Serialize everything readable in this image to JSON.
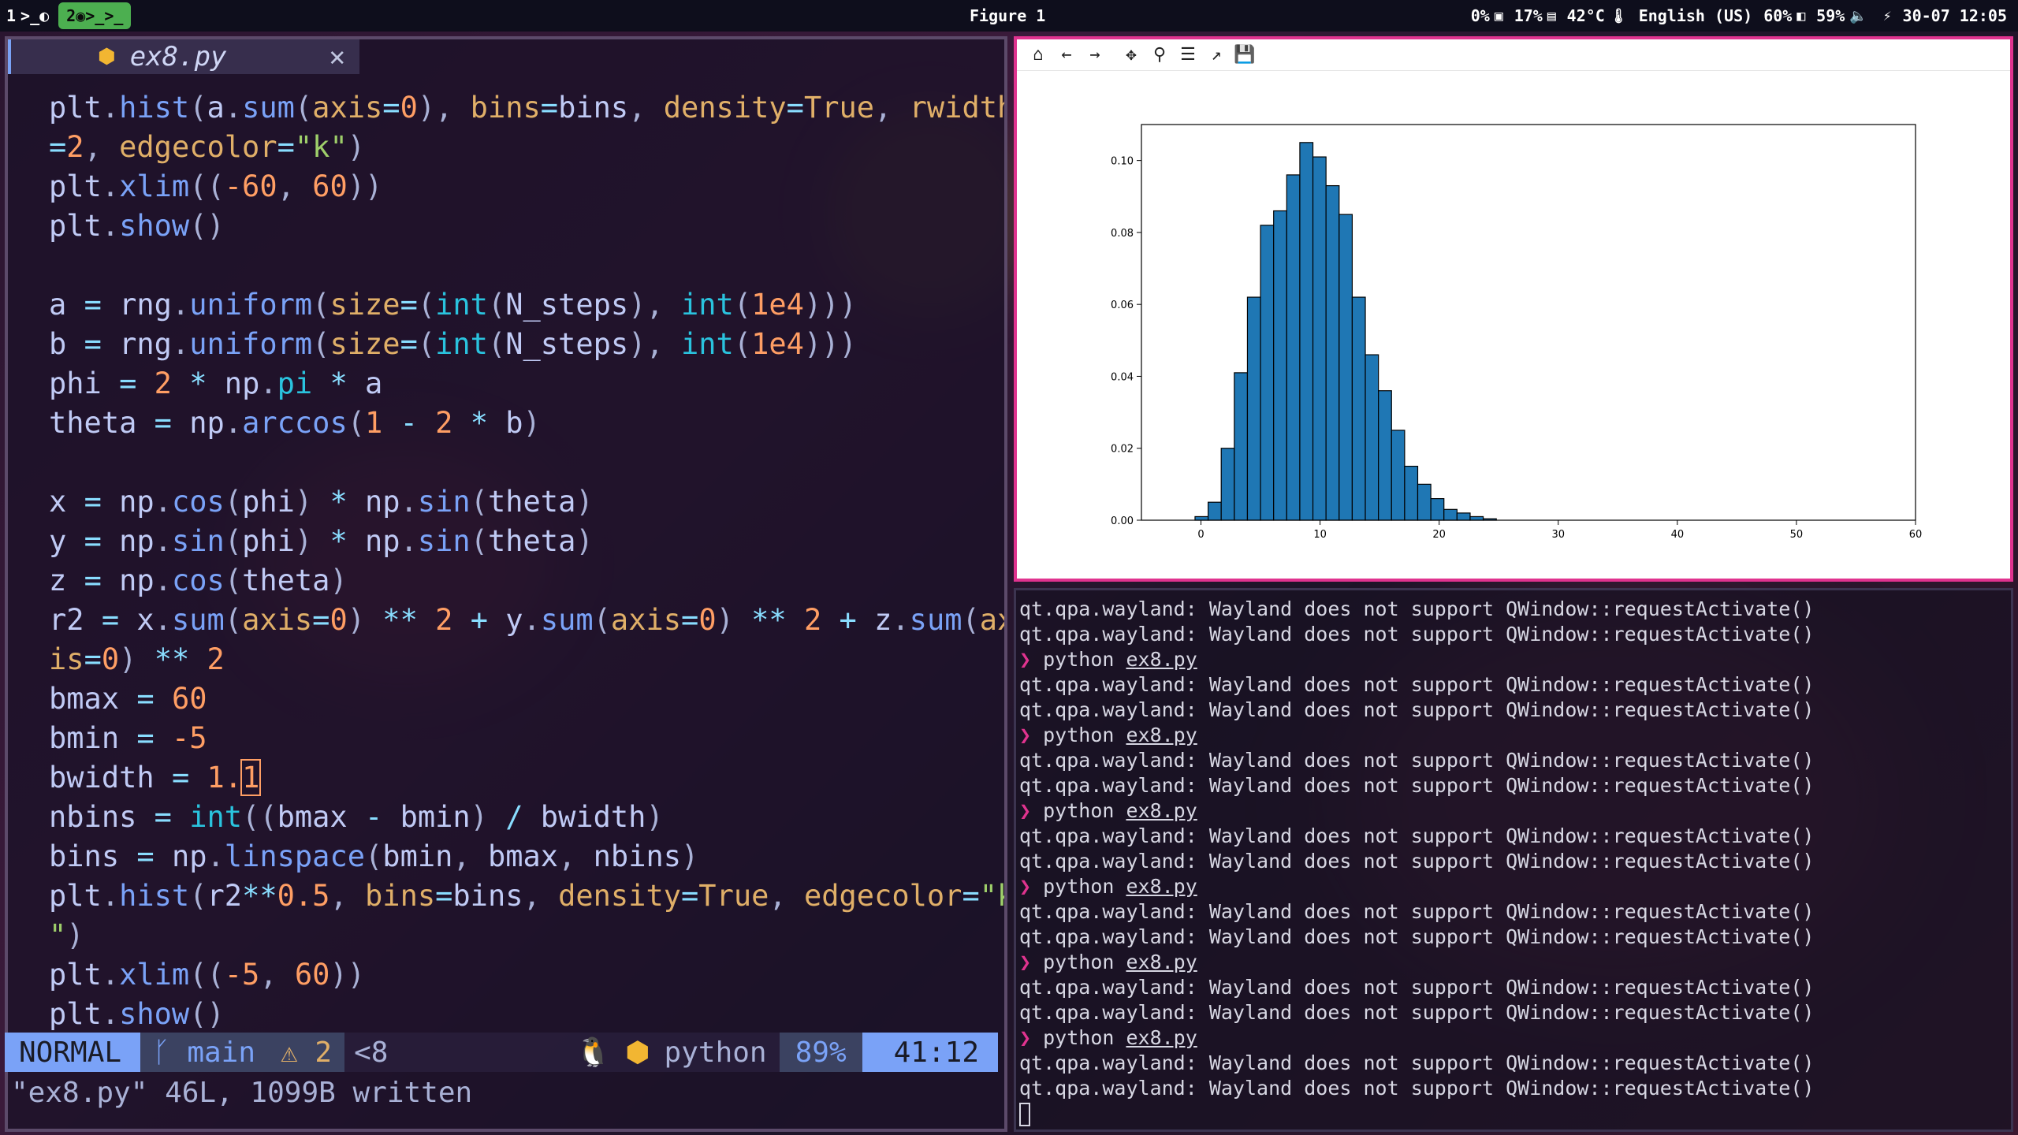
{
  "topbar": {
    "workspace1": "1",
    "workspace1_icons": ">_◐",
    "workspace2": "2",
    "workspace2_icons": "◉>_>_",
    "window_title": "Figure 1",
    "status": [
      {
        "icon": "cpu-icon",
        "glyph": "▣",
        "value": "0%"
      },
      {
        "icon": "memory-icon",
        "glyph": "▤",
        "value": "17%"
      },
      {
        "icon": "temperature-icon",
        "glyph": "🌡",
        "value": "42°C"
      },
      {
        "icon": "keyboard-layout",
        "glyph": "",
        "value": "English (US)"
      },
      {
        "icon": "display-brightness-icon",
        "glyph": "◧",
        "value": "60%"
      },
      {
        "icon": "volume-icon",
        "glyph": "🔈",
        "value": "59%"
      },
      {
        "icon": "battery-plug-icon",
        "glyph": "⚡",
        "value": ""
      },
      {
        "icon": "clock",
        "glyph": "",
        "value": "30-07 12:05"
      }
    ]
  },
  "editor": {
    "tab_filename": "ex8.py",
    "tab_icon": "python-icon",
    "statusline": {
      "mode": "NORMAL",
      "branch": "main",
      "warnings": "2",
      "diag": "<8",
      "filetype": "python",
      "percent": "89%",
      "position": "41:12"
    },
    "cmdline": "\"ex8.py\" 46L, 1099B written"
  },
  "figure": {
    "toolbar": [
      "home-icon",
      "back-icon",
      "forward-icon",
      "pan-icon",
      "zoom-icon",
      "configure-subplots-icon",
      "edit-axis-icon",
      "save-icon"
    ],
    "toolbar_glyphs": [
      "⌂",
      "←",
      "→",
      "✥",
      "⚲",
      "☰",
      "↗",
      "💾"
    ]
  },
  "chart_data": {
    "type": "bar",
    "title": "",
    "xlabel": "",
    "ylabel": "",
    "xlim": [
      -5,
      60
    ],
    "ylim": [
      0,
      0.11
    ],
    "xticks": [
      0,
      10,
      20,
      30,
      40,
      50,
      60
    ],
    "yticks": [
      "0.00",
      "0.02",
      "0.04",
      "0.06",
      "0.08",
      "0.10"
    ],
    "bin_width": 1.1,
    "bin_start": -5,
    "bar_color": "#1f77b4",
    "edge_color": "#000000",
    "bins_left": [
      -0.5,
      0.6,
      1.7,
      2.8,
      3.9,
      5.0,
      6.1,
      7.2,
      8.3,
      9.4,
      10.5,
      11.6,
      12.7,
      13.8,
      14.9,
      16.0,
      17.1,
      18.2,
      19.3,
      20.4,
      21.5,
      22.6,
      23.7
    ],
    "values": [
      0.001,
      0.005,
      0.02,
      0.041,
      0.062,
      0.082,
      0.086,
      0.096,
      0.105,
      0.101,
      0.093,
      0.085,
      0.062,
      0.046,
      0.036,
      0.025,
      0.015,
      0.01,
      0.006,
      0.003,
      0.002,
      0.001,
      0.0004
    ]
  },
  "terminal": {
    "lines": [
      {
        "kind": "out",
        "text": "qt.qpa.wayland: Wayland does not support QWindow::requestActivate()"
      },
      {
        "kind": "out",
        "text": "qt.qpa.wayland: Wayland does not support QWindow::requestActivate()"
      },
      {
        "kind": "cmd",
        "cmd": "python",
        "arg": "ex8.py"
      },
      {
        "kind": "out",
        "text": "qt.qpa.wayland: Wayland does not support QWindow::requestActivate()"
      },
      {
        "kind": "out",
        "text": "qt.qpa.wayland: Wayland does not support QWindow::requestActivate()"
      },
      {
        "kind": "cmd",
        "cmd": "python",
        "arg": "ex8.py"
      },
      {
        "kind": "out",
        "text": "qt.qpa.wayland: Wayland does not support QWindow::requestActivate()"
      },
      {
        "kind": "out",
        "text": "qt.qpa.wayland: Wayland does not support QWindow::requestActivate()"
      },
      {
        "kind": "cmd",
        "cmd": "python",
        "arg": "ex8.py"
      },
      {
        "kind": "out",
        "text": "qt.qpa.wayland: Wayland does not support QWindow::requestActivate()"
      },
      {
        "kind": "out",
        "text": "qt.qpa.wayland: Wayland does not support QWindow::requestActivate()"
      },
      {
        "kind": "cmd",
        "cmd": "python",
        "arg": "ex8.py"
      },
      {
        "kind": "out",
        "text": "qt.qpa.wayland: Wayland does not support QWindow::requestActivate()"
      },
      {
        "kind": "out",
        "text": "qt.qpa.wayland: Wayland does not support QWindow::requestActivate()"
      },
      {
        "kind": "cmd",
        "cmd": "python",
        "arg": "ex8.py"
      },
      {
        "kind": "out",
        "text": "qt.qpa.wayland: Wayland does not support QWindow::requestActivate()"
      },
      {
        "kind": "out",
        "text": "qt.qpa.wayland: Wayland does not support QWindow::requestActivate()"
      },
      {
        "kind": "cmd",
        "cmd": "python",
        "arg": "ex8.py"
      },
      {
        "kind": "out",
        "text": "qt.qpa.wayland: Wayland does not support QWindow::requestActivate()"
      },
      {
        "kind": "out",
        "text": "qt.qpa.wayland: Wayland does not support QWindow::requestActivate()"
      }
    ]
  },
  "code_lines": [
    [
      [
        "plt",
        "v"
      ],
      [
        ".",
        "p"
      ],
      [
        "hist",
        "f"
      ],
      [
        "(",
        "p"
      ],
      [
        "a",
        "v"
      ],
      [
        ".",
        "p"
      ],
      [
        "sum",
        "f"
      ],
      [
        "(",
        "p"
      ],
      [
        "axis",
        "k"
      ],
      [
        "=",
        "o"
      ],
      [
        "0",
        "n"
      ],
      [
        "), ",
        "p"
      ],
      [
        "bins",
        "k"
      ],
      [
        "=",
        "o"
      ],
      [
        "bins",
        "v"
      ],
      [
        ", ",
        "p"
      ],
      [
        "density",
        "k"
      ],
      [
        "=",
        "o"
      ],
      [
        "True",
        "k"
      ],
      [
        ", ",
        "p"
      ],
      [
        "rwidth",
        "k"
      ]
    ],
    [
      [
        "=",
        "o"
      ],
      [
        "2",
        "n"
      ],
      [
        ", ",
        "p"
      ],
      [
        "edgecolor",
        "k"
      ],
      [
        "=",
        "o"
      ],
      [
        "\"k\"",
        "s"
      ],
      [
        ")",
        "p"
      ]
    ],
    [
      [
        "plt",
        "v"
      ],
      [
        ".",
        "p"
      ],
      [
        "xlim",
        "f"
      ],
      [
        "((",
        "p"
      ],
      [
        "-60",
        "n"
      ],
      [
        ", ",
        "p"
      ],
      [
        "60",
        "n"
      ],
      [
        "))",
        "p"
      ]
    ],
    [
      [
        "plt",
        "v"
      ],
      [
        ".",
        "p"
      ],
      [
        "show",
        "f"
      ],
      [
        "()",
        "p"
      ]
    ],
    [],
    [
      [
        "a ",
        "v"
      ],
      [
        "= ",
        "o"
      ],
      [
        "rng",
        "v"
      ],
      [
        ".",
        "p"
      ],
      [
        "uniform",
        "f"
      ],
      [
        "(",
        "p"
      ],
      [
        "size",
        "k"
      ],
      [
        "=",
        "o"
      ],
      [
        "(",
        "p"
      ],
      [
        "int",
        "b"
      ],
      [
        "(",
        "p"
      ],
      [
        "N_steps",
        "v"
      ],
      [
        "), ",
        "p"
      ],
      [
        "int",
        "b"
      ],
      [
        "(",
        "p"
      ],
      [
        "1e4",
        "n"
      ],
      [
        ")))",
        "p"
      ]
    ],
    [
      [
        "b ",
        "v"
      ],
      [
        "= ",
        "o"
      ],
      [
        "rng",
        "v"
      ],
      [
        ".",
        "p"
      ],
      [
        "uniform",
        "f"
      ],
      [
        "(",
        "p"
      ],
      [
        "size",
        "k"
      ],
      [
        "=",
        "o"
      ],
      [
        "(",
        "p"
      ],
      [
        "int",
        "b"
      ],
      [
        "(",
        "p"
      ],
      [
        "N_steps",
        "v"
      ],
      [
        "), ",
        "p"
      ],
      [
        "int",
        "b"
      ],
      [
        "(",
        "p"
      ],
      [
        "1e4",
        "n"
      ],
      [
        ")))",
        "p"
      ]
    ],
    [
      [
        "phi ",
        "v"
      ],
      [
        "= ",
        "o"
      ],
      [
        "2 ",
        "n"
      ],
      [
        "* ",
        "o"
      ],
      [
        "np",
        "v"
      ],
      [
        ".",
        "p"
      ],
      [
        "pi ",
        "b"
      ],
      [
        "* ",
        "o"
      ],
      [
        "a",
        "v"
      ]
    ],
    [
      [
        "theta ",
        "v"
      ],
      [
        "= ",
        "o"
      ],
      [
        "np",
        "v"
      ],
      [
        ".",
        "p"
      ],
      [
        "arccos",
        "f"
      ],
      [
        "(",
        "p"
      ],
      [
        "1 ",
        "n"
      ],
      [
        "- ",
        "o"
      ],
      [
        "2 ",
        "n"
      ],
      [
        "* ",
        "o"
      ],
      [
        "b",
        "v"
      ],
      [
        ")",
        "p"
      ]
    ],
    [],
    [
      [
        "x ",
        "v"
      ],
      [
        "= ",
        "o"
      ],
      [
        "np",
        "v"
      ],
      [
        ".",
        "p"
      ],
      [
        "cos",
        "f"
      ],
      [
        "(",
        "p"
      ],
      [
        "phi",
        "v"
      ],
      [
        ") ",
        "p"
      ],
      [
        "* ",
        "o"
      ],
      [
        "np",
        "v"
      ],
      [
        ".",
        "p"
      ],
      [
        "sin",
        "f"
      ],
      [
        "(",
        "p"
      ],
      [
        "theta",
        "v"
      ],
      [
        ")",
        "p"
      ]
    ],
    [
      [
        "y ",
        "v"
      ],
      [
        "= ",
        "o"
      ],
      [
        "np",
        "v"
      ],
      [
        ".",
        "p"
      ],
      [
        "sin",
        "f"
      ],
      [
        "(",
        "p"
      ],
      [
        "phi",
        "v"
      ],
      [
        ") ",
        "p"
      ],
      [
        "* ",
        "o"
      ],
      [
        "np",
        "v"
      ],
      [
        ".",
        "p"
      ],
      [
        "sin",
        "f"
      ],
      [
        "(",
        "p"
      ],
      [
        "theta",
        "v"
      ],
      [
        ")",
        "p"
      ]
    ],
    [
      [
        "z ",
        "v"
      ],
      [
        "= ",
        "o"
      ],
      [
        "np",
        "v"
      ],
      [
        ".",
        "p"
      ],
      [
        "cos",
        "f"
      ],
      [
        "(",
        "p"
      ],
      [
        "theta",
        "v"
      ],
      [
        ")",
        "p"
      ]
    ],
    [
      [
        "r2 ",
        "v"
      ],
      [
        "= ",
        "o"
      ],
      [
        "x",
        "v"
      ],
      [
        ".",
        "p"
      ],
      [
        "sum",
        "f"
      ],
      [
        "(",
        "p"
      ],
      [
        "axis",
        "k"
      ],
      [
        "=",
        "o"
      ],
      [
        "0",
        "n"
      ],
      [
        ") ",
        "p"
      ],
      [
        "** ",
        "o"
      ],
      [
        "2 ",
        "n"
      ],
      [
        "+ ",
        "o"
      ],
      [
        "y",
        "v"
      ],
      [
        ".",
        "p"
      ],
      [
        "sum",
        "f"
      ],
      [
        "(",
        "p"
      ],
      [
        "axis",
        "k"
      ],
      [
        "=",
        "o"
      ],
      [
        "0",
        "n"
      ],
      [
        ") ",
        "p"
      ],
      [
        "** ",
        "o"
      ],
      [
        "2 ",
        "n"
      ],
      [
        "+ ",
        "o"
      ],
      [
        "z",
        "v"
      ],
      [
        ".",
        "p"
      ],
      [
        "sum",
        "f"
      ],
      [
        "(",
        "p"
      ],
      [
        "ax",
        "k"
      ]
    ],
    [
      [
        "is",
        "k"
      ],
      [
        "=",
        "o"
      ],
      [
        "0",
        "n"
      ],
      [
        ") ",
        "p"
      ],
      [
        "** ",
        "o"
      ],
      [
        "2",
        "n"
      ]
    ],
    [
      [
        "bmax ",
        "v"
      ],
      [
        "= ",
        "o"
      ],
      [
        "60",
        "n"
      ]
    ],
    [
      [
        "bmin ",
        "v"
      ],
      [
        "= ",
        "o"
      ],
      [
        "-5",
        "n"
      ]
    ],
    [
      [
        "bwidth ",
        "v"
      ],
      [
        "= ",
        "o"
      ],
      [
        "1.",
        "n"
      ],
      [
        "1",
        "n",
        "cursor"
      ]
    ],
    [
      [
        "nbins ",
        "v"
      ],
      [
        "= ",
        "o"
      ],
      [
        "int",
        "b"
      ],
      [
        "((",
        "p"
      ],
      [
        "bmax ",
        "v"
      ],
      [
        "- ",
        "o"
      ],
      [
        "bmin",
        "v"
      ],
      [
        ") ",
        "p"
      ],
      [
        "/ ",
        "o"
      ],
      [
        "bwidth",
        "v"
      ],
      [
        ")",
        "p"
      ]
    ],
    [
      [
        "bins ",
        "v"
      ],
      [
        "= ",
        "o"
      ],
      [
        "np",
        "v"
      ],
      [
        ".",
        "p"
      ],
      [
        "linspace",
        "f"
      ],
      [
        "(",
        "p"
      ],
      [
        "bmin",
        "v"
      ],
      [
        ", ",
        "p"
      ],
      [
        "bmax",
        "v"
      ],
      [
        ", ",
        "p"
      ],
      [
        "nbins",
        "v"
      ],
      [
        ")",
        "p"
      ]
    ],
    [
      [
        "plt",
        "v"
      ],
      [
        ".",
        "p"
      ],
      [
        "hist",
        "f"
      ],
      [
        "(",
        "p"
      ],
      [
        "r2",
        "v"
      ],
      [
        "**",
        "o"
      ],
      [
        "0.5",
        "n"
      ],
      [
        ", ",
        "p"
      ],
      [
        "bins",
        "k"
      ],
      [
        "=",
        "o"
      ],
      [
        "bins",
        "v"
      ],
      [
        ", ",
        "p"
      ],
      [
        "density",
        "k"
      ],
      [
        "=",
        "o"
      ],
      [
        "True",
        "k"
      ],
      [
        ", ",
        "p"
      ],
      [
        "edgecolor",
        "k"
      ],
      [
        "=",
        "o"
      ],
      [
        "\"k",
        "s"
      ]
    ],
    [
      [
        "\"",
        "s"
      ],
      [
        ")",
        "p"
      ]
    ],
    [
      [
        "plt",
        "v"
      ],
      [
        ".",
        "p"
      ],
      [
        "xlim",
        "f"
      ],
      [
        "((",
        "p"
      ],
      [
        "-5",
        "n"
      ],
      [
        ", ",
        "p"
      ],
      [
        "60",
        "n"
      ],
      [
        "))",
        "p"
      ]
    ],
    [
      [
        "plt",
        "v"
      ],
      [
        ".",
        "p"
      ],
      [
        "show",
        "f"
      ],
      [
        "()",
        "p"
      ]
    ]
  ]
}
